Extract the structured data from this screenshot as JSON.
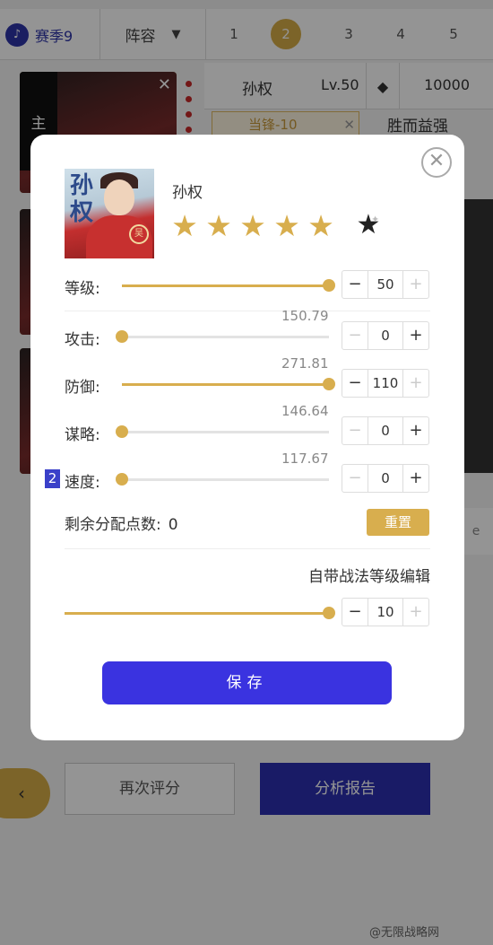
{
  "topbar": {
    "season_label": "赛季9",
    "lineup_label": "阵容",
    "tabs": [
      "1",
      "2",
      "3",
      "4",
      "5"
    ],
    "active_tab": "2"
  },
  "background": {
    "card_main_label": "主",
    "hero_name": "孙权",
    "hero_level": "Lv.50",
    "power": "10000",
    "tactic_tag": "当锋-10",
    "tactic_2": "胜而益强",
    "side_label": "e"
  },
  "bottom": {
    "rescore_label": "再次评分",
    "report_label": "分析报告"
  },
  "watermark": "@无限战略网",
  "modal": {
    "hero_name": "孙权",
    "avatar_text": "孙权",
    "avatar_seal": "吴",
    "stars_count": 5,
    "stats": [
      {
        "key": "level",
        "label": "等级:",
        "display": "",
        "value": "50",
        "fill": 1.0
      },
      {
        "key": "attack",
        "label": "攻击:",
        "display": "150.79",
        "value": "0",
        "fill": 0.0
      },
      {
        "key": "defense",
        "label": "防御:",
        "display": "271.81",
        "value": "110",
        "fill": 1.0
      },
      {
        "key": "strategy",
        "label": "谋略:",
        "display": "146.64",
        "value": "0",
        "fill": 0.0
      },
      {
        "key": "speed",
        "label": "速度:",
        "display": "117.67",
        "value": "0",
        "fill": 0.0
      }
    ],
    "speed_badge": "2",
    "remaining_label": "剩余分配点数:",
    "remaining_value": "0",
    "reset_label": "重置",
    "tactic_level_title": "自带战法等级编辑",
    "tactic_level_value": "10",
    "tactic_level_fill": 1.0,
    "save_label": "保存",
    "colors": {
      "accent": "#d8ae4e",
      "primary": "#3a33e0"
    }
  }
}
